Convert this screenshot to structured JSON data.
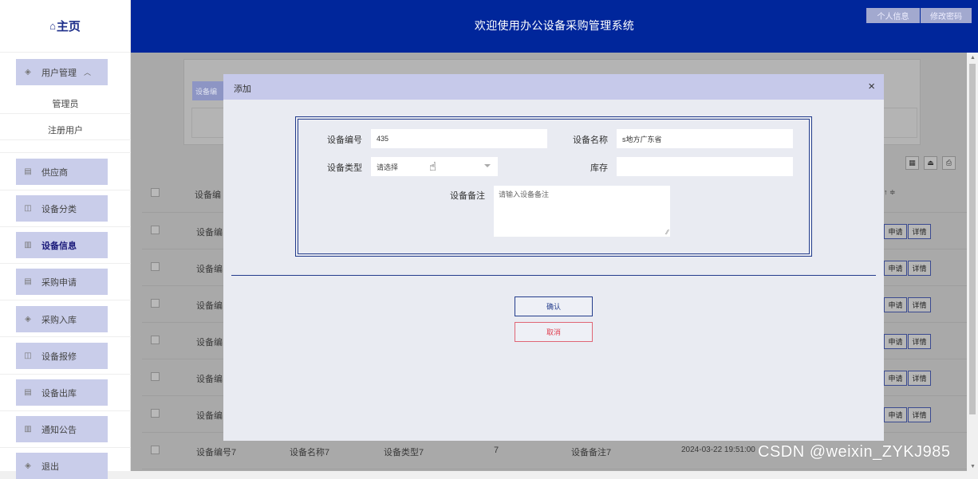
{
  "sidebar": {
    "home": "主页",
    "user_mgmt": "用户管理",
    "user_sub": [
      "管理员",
      "注册用户"
    ],
    "items": [
      "供应商",
      "设备分类",
      "设备信息",
      "采购申请",
      "采购入库",
      "设备报修",
      "设备出库",
      "通知公告",
      "退出"
    ],
    "active_index": 2
  },
  "header": {
    "title": "欢迎使用办公设备采购管理系统",
    "profile_btn": "个人信息",
    "password_btn": "修改密码"
  },
  "background": {
    "search_btn": "设备编",
    "col_header": "设备编",
    "sort_mark": "↑ ≑",
    "row_label": "设备编",
    "apply_btn": "申请",
    "detail_btn": "详情",
    "last_row": {
      "code": "设备编号7",
      "name": "设备名称7",
      "type": "设备类型7",
      "stock": "7",
      "remark": "设备备注7",
      "time": "2024-03-22 19:51:00"
    }
  },
  "watermark": "CSDN @weixin_ZYKJ985",
  "modal": {
    "title": "添加",
    "close": "×",
    "fields": {
      "code_label": "设备编号",
      "code_value": "435",
      "name_label": "设备名称",
      "name_value": "s地方广东省",
      "type_label": "设备类型",
      "type_value": "请选择",
      "stock_label": "库存",
      "stock_value": "",
      "remark_label": "设备备注",
      "remark_placeholder": "请输入设备备注"
    },
    "confirm": "确认",
    "cancel": "取消"
  },
  "colors": {
    "header_bg": "#00269b",
    "menu_bg": "#c9cdea",
    "modal_head": "#c6c9ea",
    "accent": "#233c8c",
    "danger": "#e04050"
  }
}
